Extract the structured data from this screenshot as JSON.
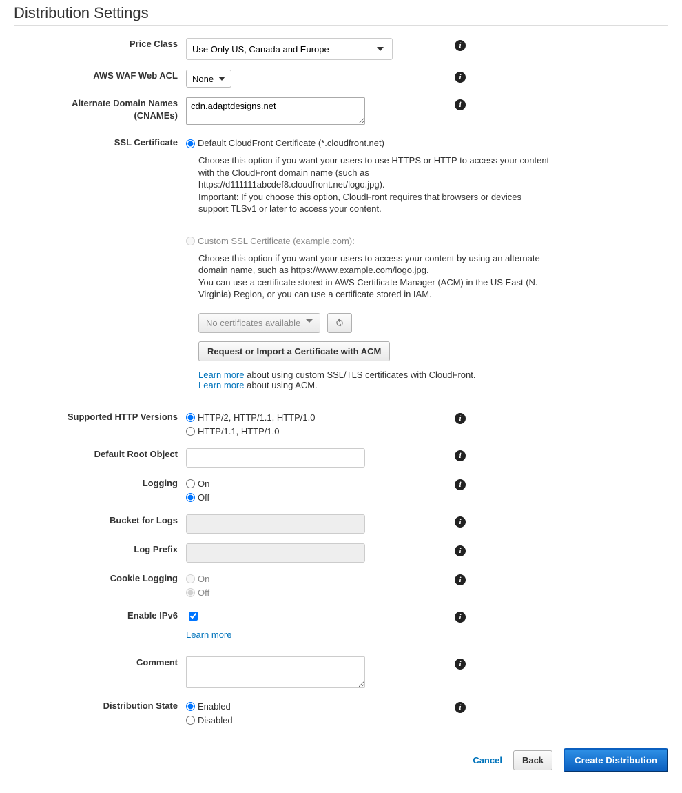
{
  "page": {
    "title": "Distribution Settings"
  },
  "labels": {
    "price_class": "Price Class",
    "waf": "AWS WAF Web ACL",
    "cnames_line1": "Alternate Domain Names",
    "cnames_line2": "(CNAMEs)",
    "ssl": "SSL Certificate",
    "http_versions": "Supported HTTP Versions",
    "default_root": "Default Root Object",
    "logging": "Logging",
    "bucket_logs": "Bucket for Logs",
    "log_prefix": "Log Prefix",
    "cookie_logging": "Cookie Logging",
    "enable_ipv6": "Enable IPv6",
    "comment": "Comment",
    "dist_state": "Distribution State"
  },
  "price_class": {
    "selected": "Use Only US, Canada and Europe"
  },
  "waf": {
    "selected": "None"
  },
  "cnames": {
    "value": "cdn.adaptdesigns.net"
  },
  "ssl": {
    "default_label": "Default CloudFront Certificate (*.cloudfront.net)",
    "default_help": "Choose this option if you want your users to use HTTPS or HTTP to access your content with the CloudFront domain name (such as https://d111111abcdef8.cloudfront.net/logo.jpg).\nImportant: If you choose this option, CloudFront requires that browsers or devices support TLSv1 or later to access your content.",
    "custom_label": "Custom SSL Certificate (example.com):",
    "custom_help": "Choose this option if you want your users to access your content by using an alternate domain name, such as https://www.example.com/logo.jpg.\nYou can use a certificate stored in AWS Certificate Manager (ACM) in the US East (N. Virginia) Region, or you can use a certificate stored in IAM.",
    "no_certs": "No certificates available",
    "request_btn": "Request or Import a Certificate with ACM",
    "learn_more": "Learn more",
    "learn_more_ssl_suffix": " about using custom SSL/TLS certificates with CloudFront.",
    "learn_more_acm_suffix": " about using ACM."
  },
  "http_versions": {
    "opt1": "HTTP/2, HTTP/1.1, HTTP/1.0",
    "opt2": "HTTP/1.1, HTTP/1.0"
  },
  "default_root": {
    "value": ""
  },
  "logging": {
    "on": "On",
    "off": "Off"
  },
  "bucket_logs": {
    "value": ""
  },
  "log_prefix": {
    "value": ""
  },
  "cookie_logging": {
    "on": "On",
    "off": "Off"
  },
  "ipv6": {
    "learn_more": "Learn more"
  },
  "comment": {
    "value": ""
  },
  "dist_state": {
    "enabled": "Enabled",
    "disabled": "Disabled"
  },
  "footer": {
    "cancel": "Cancel",
    "back": "Back",
    "create": "Create Distribution"
  }
}
